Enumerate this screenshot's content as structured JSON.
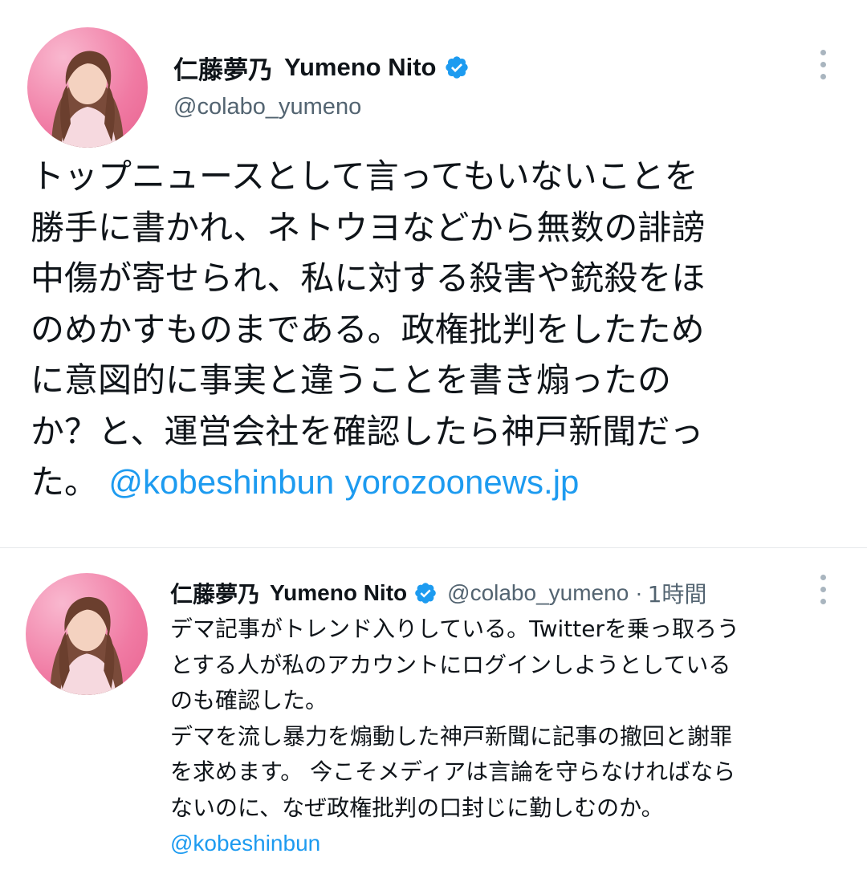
{
  "main_tweet": {
    "author_name_ja": "仁藤夢乃",
    "author_name_en": "Yumeno Nito",
    "handle": "@colabo_yumeno",
    "body": "トップニュースとして言ってもいないことを\n勝手に書かれ、ネトウヨなどから無数の誹謗\n中傷が寄せられ、私に対する殺害や銃殺をほ\nのめかすものまである。政権批判をしたため\nに意図的に事実と違うことを書き煽ったの\nか？と、運営会社を確認したら神戸新聞だっ\nた。",
    "mention": "@kobeshinbun",
    "link_text": "yorozoonews.jp"
  },
  "reply_tweet": {
    "author_name_ja": "仁藤夢乃",
    "author_name_en": "Yumeno Nito",
    "handle": "@colabo_yumeno",
    "separator": "·",
    "time": "1時間",
    "body": "デマ記事がトレンド入りしている。Twitterを乗っ取ろう\nとする人が私のアカウントにログインしようとしている\nのも確認した。\nデマを流し暴力を煽動した神戸新聞に記事の撤回と謝罪\nを求めます。 今こそメディアは言論を守らなければなら\nないのに、なぜ政権批判の口封じに勤しむのか。",
    "mention": "@kobeshinbun"
  },
  "icons": {
    "verified": "verified-badge-icon",
    "more": "more-options-icon"
  },
  "colors": {
    "link": "#1d9bf0",
    "secondary_text": "#536471",
    "avatar_background": "#f07aa3"
  }
}
